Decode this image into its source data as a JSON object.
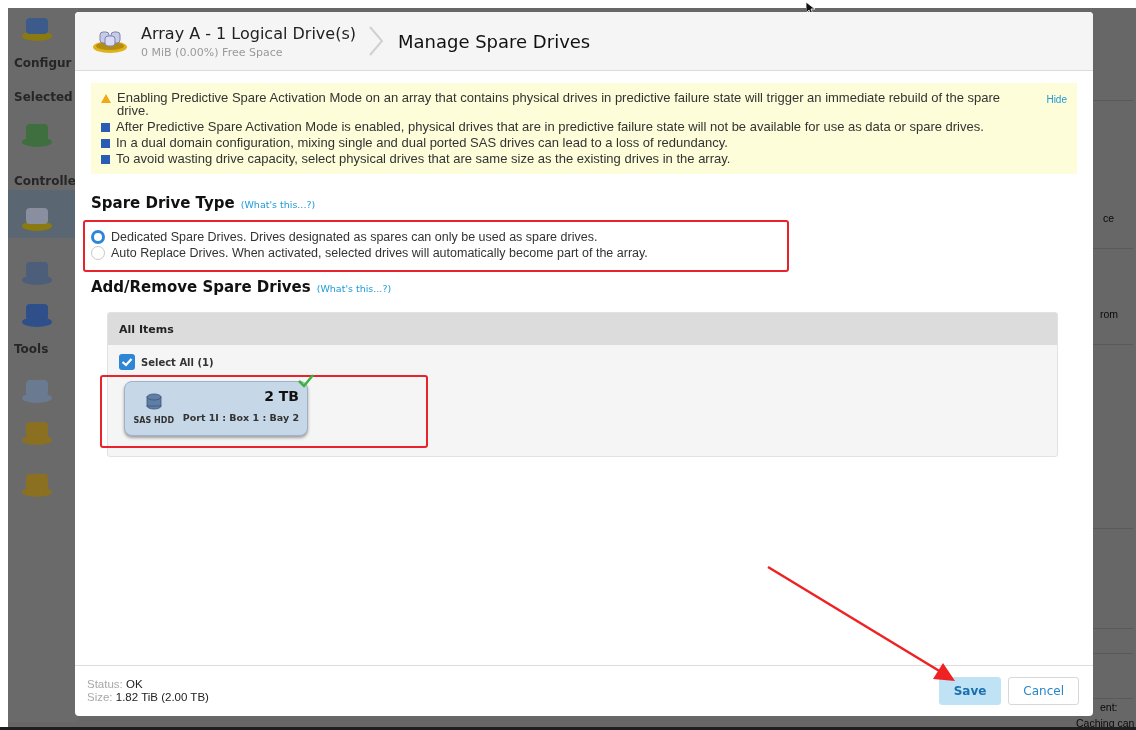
{
  "background": {
    "sidebar_headings": [
      "Configur",
      "Selected",
      "Controlle",
      "Tools"
    ],
    "right_fragments": [
      "ce",
      "rom",
      "ent:",
      "Caching can"
    ]
  },
  "dialog": {
    "breadcrumb": {
      "title": "Array A - 1 Logical Drive(s)",
      "subtitle": "0 MiB (0.00%) Free Space",
      "page": "Manage Spare Drives"
    },
    "hide_link": "Hide",
    "notices": [
      {
        "kind": "warning",
        "text": "Enabling Predictive Spare Activation Mode on an array that contains physical drives in predictive failure state will trigger an immediate rebuild of the spare drive."
      },
      {
        "kind": "info",
        "text": "After Predictive Spare Activation Mode is enabled, physical drives that are in predictive failure state will not be available for use as data or spare drives."
      },
      {
        "kind": "info",
        "text": "In a dual domain configuration, mixing single and dual ported SAS drives can lead to a loss of redundancy."
      },
      {
        "kind": "info",
        "text": "To avoid wasting drive capacity, select physical drives that are same size as the existing drives in the array."
      }
    ],
    "spare_type": {
      "heading": "Spare Drive Type",
      "help_link": "(What's this...?)",
      "options": [
        {
          "label": "Dedicated Spare Drives. Drives designated as spares can only be used as spare drives.",
          "selected": true
        },
        {
          "label": "Auto Replace Drives. When activated, selected drives will automatically become part of the array.",
          "selected": false
        }
      ]
    },
    "add_remove": {
      "heading": "Add/Remove Spare Drives",
      "help_link": "(What's this...?)",
      "list_header": "All Items",
      "select_all": {
        "label": "Select All (1)",
        "checked": true
      },
      "drives": [
        {
          "capacity": "2 TB",
          "type": "SAS HDD",
          "location": "Port 1I : Box 1 : Bay 2",
          "selected": true
        }
      ]
    },
    "footer": {
      "status_label": "Status:",
      "status_value": "OK",
      "size_label": "Size:",
      "size_value": "1.82 TiB (2.00 TB)"
    },
    "buttons": [
      {
        "label": "Save",
        "kind": "primary"
      },
      {
        "label": "Cancel",
        "kind": "secondary"
      }
    ]
  }
}
